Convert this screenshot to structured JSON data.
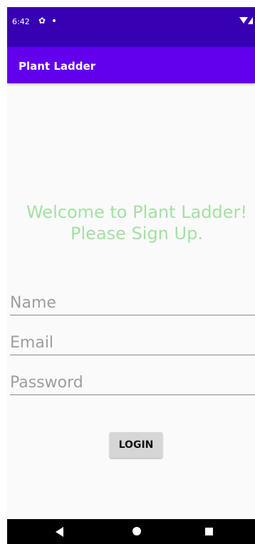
{
  "status_bar": {
    "time": "6:42",
    "icons": [
      "gear-icon",
      "notification-dot-icon",
      "wifi-icon",
      "signal-icon"
    ]
  },
  "app_bar": {
    "title": "Plant Ladder"
  },
  "welcome": {
    "line1": "Welcome to Plant Ladder!",
    "line2": "Please Sign Up."
  },
  "form": {
    "name_placeholder": "Name",
    "email_placeholder": "Email",
    "password_placeholder": "Password",
    "name_value": "",
    "email_value": "",
    "password_value": "",
    "login_label": "LOGIN"
  },
  "nav_bar": {
    "icons": [
      "back-icon",
      "home-icon",
      "recents-icon"
    ]
  },
  "colors": {
    "status_bar": "#3700b3",
    "app_bar": "#6200ee",
    "welcome_text": "#a5e0a4",
    "background": "#fafafa",
    "button": "#d6d6d6"
  }
}
